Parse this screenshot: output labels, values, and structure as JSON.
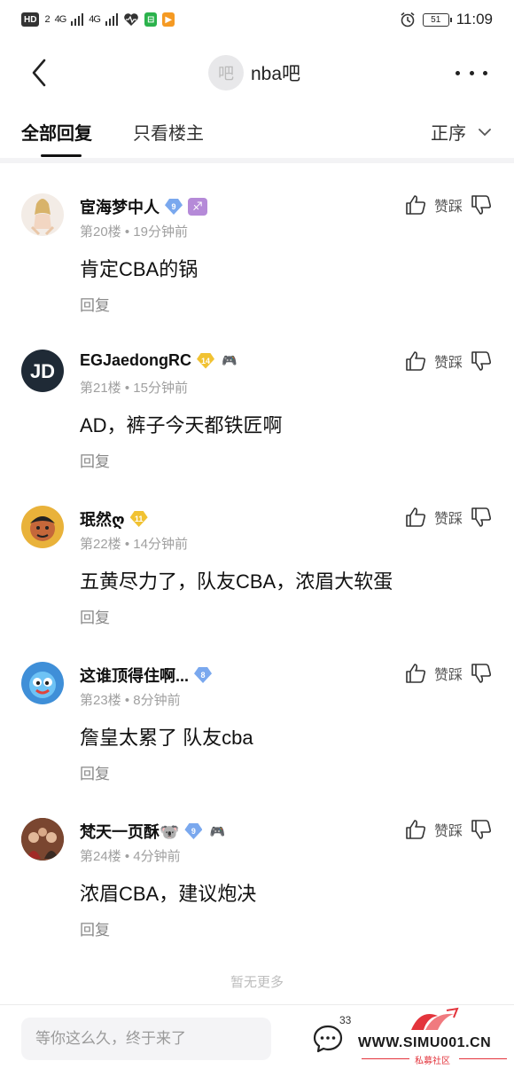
{
  "status_bar": {
    "hd": "HD",
    "sim": "2",
    "net1": "4G",
    "net2": "4G",
    "battery": "51",
    "time": "11:09"
  },
  "nav": {
    "forum_logo": "吧",
    "forum_name": "nba吧"
  },
  "tabs": {
    "all": "全部回复",
    "owner_only": "只看楼主",
    "sort": "正序"
  },
  "vote_label": "赞踩",
  "reply_label": "回复",
  "comments": [
    {
      "username": "宦海梦中人",
      "level": "9",
      "level_color": "#7aa8ee",
      "extra": "♐",
      "floor": "第20楼",
      "time": "19分钟前",
      "text": "肯定CBA的锅"
    },
    {
      "username": "EGJaedongRC",
      "level": "14",
      "level_color": "#f1c232",
      "extra": "🎮",
      "floor": "第21楼",
      "time": "15分钟前",
      "text": "AD，裤子今天都铁匠啊"
    },
    {
      "username": "珉然ღ",
      "level": "11",
      "level_color": "#f1c232",
      "extra": "",
      "floor": "第22楼",
      "time": "14分钟前",
      "text": "五黄尽力了，队友CBA，浓眉大软蛋"
    },
    {
      "username": "这谁顶得住啊...",
      "level": "8",
      "level_color": "#7aa8ee",
      "extra": "",
      "floor": "第23楼",
      "time": "8分钟前",
      "text": "詹皇太累了 队友cba"
    },
    {
      "username": "梵天一页酥🐨",
      "level": "9",
      "level_color": "#7aa8ee",
      "extra": "🎮",
      "floor": "第24楼",
      "time": "4分钟前",
      "text": "浓眉CBA，建议炮决"
    }
  ],
  "no_more": "暂无更多",
  "bottom": {
    "placeholder": "等你这么久，终于来了",
    "comment_count": "33"
  },
  "watermark": {
    "url": "WWW.SIMU001.CN",
    "sub": "私募社区"
  },
  "colors": {
    "badge_blue": "#7aa8ee",
    "badge_gold": "#f1c232",
    "watermark_red": "#e3343c"
  }
}
